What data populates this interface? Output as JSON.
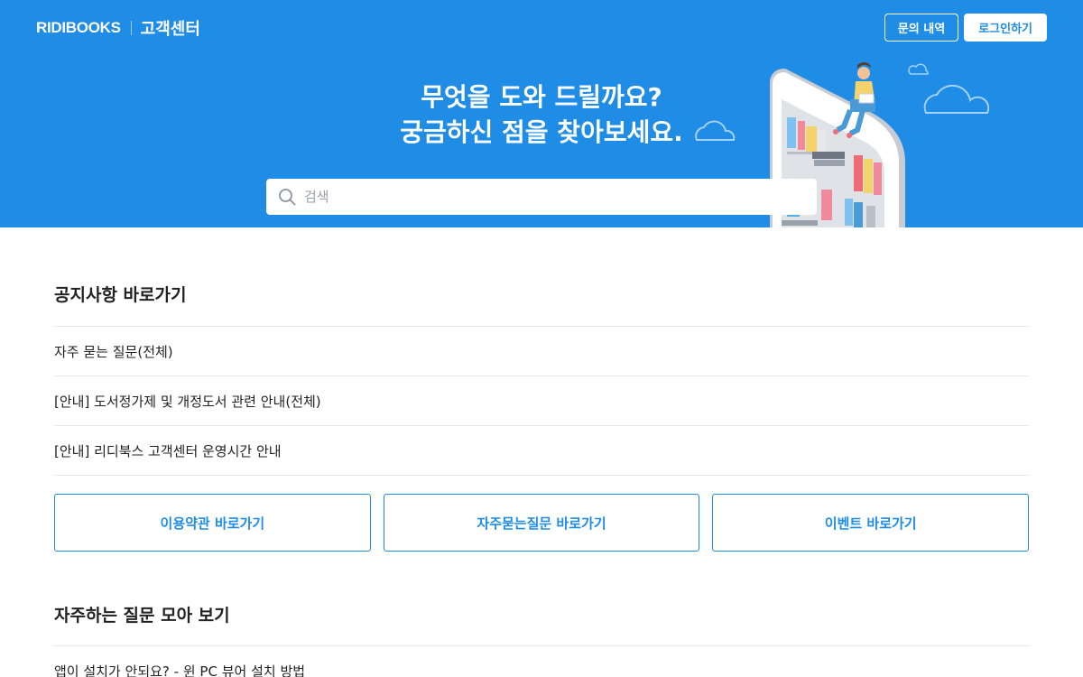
{
  "header": {
    "logo": "RIDIBOOKS",
    "subtitle": "고객센터",
    "my_inquiry_button": "문의 내역",
    "login_button": "로그인하기"
  },
  "hero": {
    "title_line1": "무엇을 도와 드릴까요?",
    "title_line2": "궁금하신 점을 찾아보세요."
  },
  "search": {
    "placeholder": "검색"
  },
  "notice_section": {
    "title": "공지사항 바로가기",
    "items": [
      "자주 묻는 질문(전체)",
      "[안내] 도서정가제 및 개정도서 관련 안내(전체)",
      "[안내] 리디북스 고객센터 운영시간 안내"
    ]
  },
  "cards": [
    "이용약관 바로가기",
    "자주묻는질문 바로가기",
    "이벤트 바로가기"
  ],
  "faq_section": {
    "title": "자주하는 질문 모아 보기",
    "items": [
      "앱이 설치가 안되요? - 윈 PC 뷰어 설치 방법"
    ]
  },
  "colors": {
    "brand_blue": "#1f8ce6",
    "white": "#ffffff"
  }
}
